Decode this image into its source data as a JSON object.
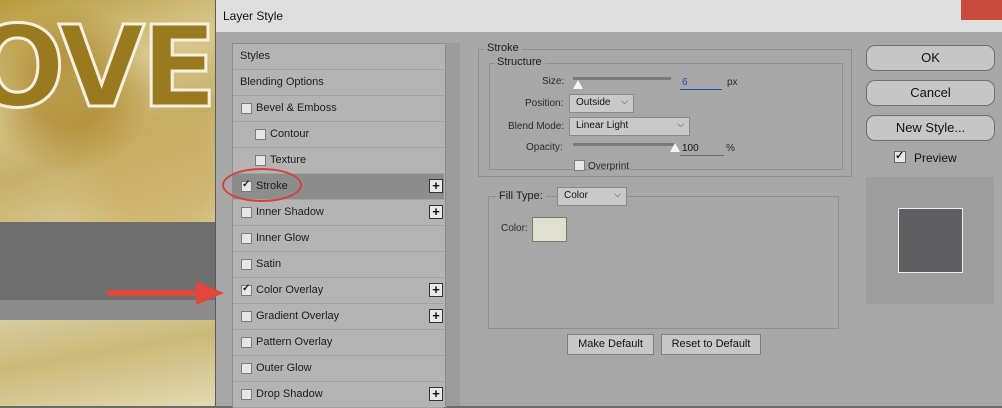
{
  "background": {
    "title_fragment": "OVER"
  },
  "dialog": {
    "title": "Layer Style",
    "list": [
      {
        "label": "Styles",
        "checkbox": false,
        "checked": false,
        "plus": false,
        "indent": 0
      },
      {
        "label": "Blending Options",
        "checkbox": false,
        "checked": false,
        "plus": false,
        "indent": 0
      },
      {
        "label": "Bevel & Emboss",
        "checkbox": true,
        "checked": false,
        "plus": false,
        "indent": 0
      },
      {
        "label": "Contour",
        "checkbox": true,
        "checked": false,
        "plus": false,
        "indent": 1
      },
      {
        "label": "Texture",
        "checkbox": true,
        "checked": false,
        "plus": false,
        "indent": 1
      },
      {
        "label": "Stroke",
        "checkbox": true,
        "checked": true,
        "plus": true,
        "indent": 0,
        "selected": true
      },
      {
        "label": "Inner Shadow",
        "checkbox": true,
        "checked": false,
        "plus": true,
        "indent": 0
      },
      {
        "label": "Inner Glow",
        "checkbox": true,
        "checked": false,
        "plus": false,
        "indent": 0
      },
      {
        "label": "Satin",
        "checkbox": true,
        "checked": false,
        "plus": false,
        "indent": 0
      },
      {
        "label": "Color Overlay",
        "checkbox": true,
        "checked": true,
        "plus": true,
        "indent": 0
      },
      {
        "label": "Gradient Overlay",
        "checkbox": true,
        "checked": false,
        "plus": true,
        "indent": 0
      },
      {
        "label": "Pattern Overlay",
        "checkbox": true,
        "checked": false,
        "plus": false,
        "indent": 0
      },
      {
        "label": "Outer Glow",
        "checkbox": true,
        "checked": false,
        "plus": false,
        "indent": 0
      },
      {
        "label": "Drop Shadow",
        "checkbox": true,
        "checked": false,
        "plus": true,
        "indent": 0
      }
    ],
    "stroke": {
      "section_title": "Stroke",
      "structure_title": "Structure",
      "size": {
        "label": "Size:",
        "value": "6",
        "unit": "px"
      },
      "position": {
        "label": "Position:",
        "value": "Outside"
      },
      "blend_mode": {
        "label": "Blend Mode:",
        "value": "Linear Light"
      },
      "opacity": {
        "label": "Opacity:",
        "value": "100",
        "unit": "%",
        "level": 1.0
      },
      "overprint": {
        "label": "Overprint",
        "checked": false
      },
      "fill_type": {
        "label": "Fill Type:",
        "value": "Color"
      },
      "color": {
        "label": "Color:",
        "swatch": "#dfe0ce"
      },
      "make_default": "Make Default",
      "reset_default": "Reset to Default"
    },
    "buttons": {
      "ok": "OK",
      "cancel": "Cancel",
      "new_style": "New Style..."
    },
    "preview": {
      "label": "Preview",
      "checked": true,
      "swatch": "#5f5e60"
    }
  },
  "annotation_color": "#d6403a"
}
